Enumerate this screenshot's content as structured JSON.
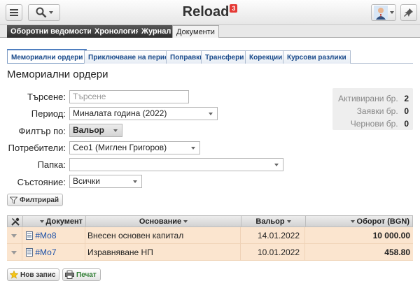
{
  "app": {
    "title": "Reload",
    "notification_count": "3"
  },
  "top_bar": {
    "menu_icon": "hamburger-icon",
    "search_icon": "magnifier-icon",
    "pin_icon": "pin-icon",
    "avatar_icon": "user-avatar-icon"
  },
  "nav_tabs": [
    {
      "label": "Оборотни ведомости",
      "active": false
    },
    {
      "label": "Хронология",
      "active": false
    },
    {
      "label": "Журнал",
      "active": false
    },
    {
      "label": "Документи",
      "active": true
    }
  ],
  "sub_tabs": [
    {
      "label": "Мемориални ордери",
      "active": true
    },
    {
      "label": "Приключване на период",
      "active": false
    },
    {
      "label": "Поправки",
      "active": false
    },
    {
      "label": "Трансфери",
      "active": false
    },
    {
      "label": "Корекции",
      "active": false
    },
    {
      "label": "Курсови разлики",
      "active": false
    }
  ],
  "page_title": "Мемориални ордери",
  "form": {
    "search_label": "Търсене:",
    "search_placeholder": "Търсене",
    "period_label": "Период:",
    "period_value": "Миналата година (2022)",
    "filter_label": "Филтър по:",
    "filter_value": "Вальор",
    "users_label": "Потребители:",
    "users_value": "Сео1 (Миглен Григоров)",
    "folder_label": "Папка:",
    "folder_value": "",
    "state_label": "Състояние:",
    "state_value": "Всички",
    "filter_button": "Филтрирай"
  },
  "stats": {
    "activated_label": "Активирани бр.",
    "activated_value": "2",
    "requests_label": "Заявки бр.",
    "requests_value": "0",
    "drafts_label": "Чернови бр.",
    "drafts_value": "0"
  },
  "table": {
    "headers": {
      "document": "Документ",
      "basis": "Основание",
      "valor": "Вальор",
      "turnover": "Оборот (BGN)"
    },
    "rows": [
      {
        "document": "#Мо8",
        "basis": "Внесен основен капитал",
        "valor": "14.01.2022",
        "turnover": "10 000.00"
      },
      {
        "document": "#Мо7",
        "basis": "Изравняване НП",
        "valor": "10.01.2022",
        "turnover": "458.80"
      }
    ]
  },
  "actions": {
    "new_record": "Нов запис",
    "print": "Печат"
  },
  "colors": {
    "row_bg": "#fbe5cf",
    "tab_blue": "#1a4a8a",
    "badge_red": "#e53935",
    "print_green": "#2e7d32"
  }
}
